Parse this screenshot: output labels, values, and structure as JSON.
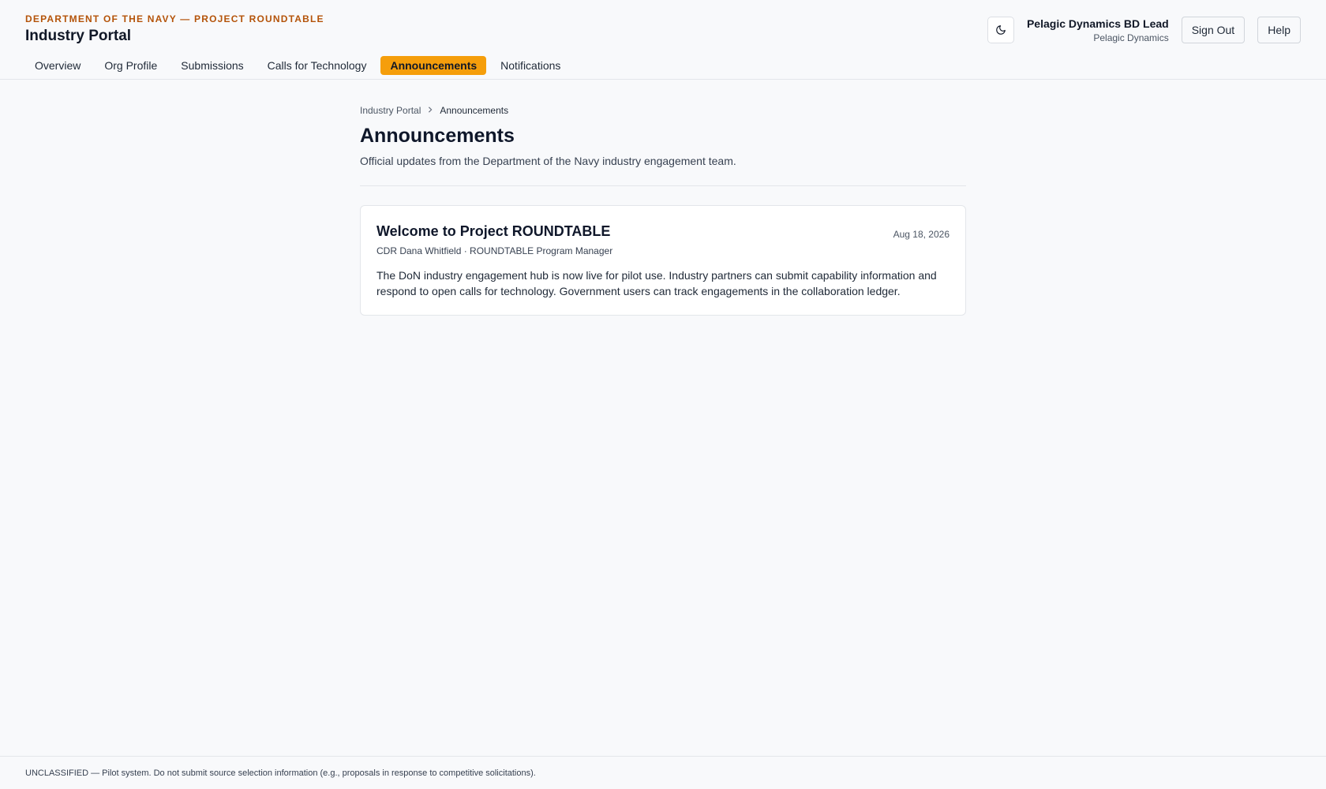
{
  "header": {
    "eyebrow": "DEPARTMENT OF THE NAVY — PROJECT ROUNDTABLE",
    "title": "Industry Portal",
    "nav": [
      {
        "label": "Overview",
        "active": false
      },
      {
        "label": "Org Profile",
        "active": false
      },
      {
        "label": "Submissions",
        "active": false
      },
      {
        "label": "Calls for Technology",
        "active": false
      },
      {
        "label": "Announcements",
        "active": true
      },
      {
        "label": "Notifications",
        "active": false
      }
    ],
    "theme_icon": "moon-icon",
    "user_name": "Pelagic Dynamics BD Lead",
    "user_org": "Pelagic Dynamics",
    "sign_out_label": "Sign Out",
    "help_label": "Help"
  },
  "breadcrumb": {
    "root": "Industry Portal",
    "current": "Announcements",
    "separator_icon": "chevron-right-icon"
  },
  "page": {
    "title": "Announcements",
    "subtitle": "Official updates from the Department of the Navy industry engagement team."
  },
  "announcements": [
    {
      "title": "Welcome to Project ROUNDTABLE",
      "date": "Aug 18, 2026",
      "author": "CDR Dana Whitfield · ROUNDTABLE Program Manager",
      "body": "The DoN industry engagement hub is now live for pilot use. Industry partners can submit capability information and respond to open calls for technology. Government users can track engagements in the collaboration ledger."
    }
  ],
  "footer": {
    "text": "UNCLASSIFIED — Pilot system. Do not submit source selection information (e.g., proposals in response to competitive solicitations)."
  },
  "colors": {
    "accent": "#f59e0b",
    "eyebrow": "#b45309"
  }
}
